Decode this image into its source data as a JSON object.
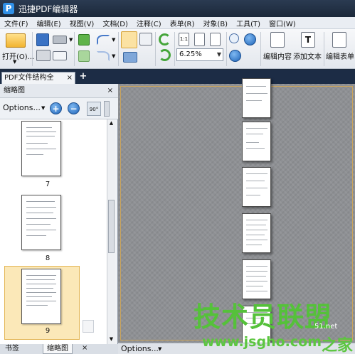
{
  "window": {
    "title": "迅捷PDF编辑器"
  },
  "menu": [
    "文件(F)",
    "编辑(E)",
    "视图(V)",
    "文档(D)",
    "注释(C)",
    "表单(R)",
    "对象(B)",
    "工具(T)",
    "窗口(W)"
  ],
  "toolbar": {
    "open_label": "打开(O)...",
    "zoom_value": "6.25%",
    "edit_content_label": "编辑内容",
    "add_text_label": "添加文本",
    "edit_form_label": "编辑表单",
    "page_fit_label": "1:1"
  },
  "tabs": {
    "document_tab": "PDF文件结构全",
    "close": "×",
    "new_tab": "+"
  },
  "thumbnail_panel": {
    "title": "缩略图",
    "close": "×",
    "options_label": "Options...",
    "rotate_label": "90°",
    "pages": [
      "7",
      "8",
      "9"
    ],
    "bottom_tabs": [
      "书签",
      "缩略图"
    ]
  },
  "statusbar": {
    "options_label": "Options..."
  },
  "watermark": {
    "big": "技术员联盟",
    "small": "www.jsgho.com",
    "side": "之家",
    "site": "51.net"
  },
  "colors": {
    "title_bg": "#1b283a",
    "accent_blue": "#2f8fe6",
    "selection": "#fbe8b8",
    "watermark_green": "#55c13a"
  }
}
